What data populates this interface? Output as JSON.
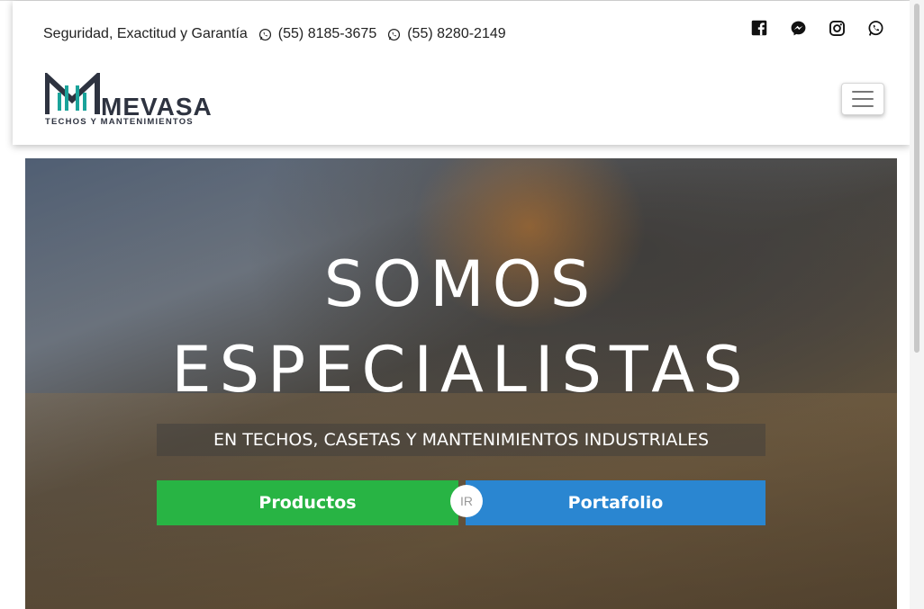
{
  "topbar": {
    "tagline": "Seguridad, Exactitud y Garantía",
    "phones": [
      "(55) 8185-3675",
      "(55) 8280-2149"
    ]
  },
  "socials": [
    "facebook-icon",
    "messenger-icon",
    "instagram-icon",
    "whatsapp-icon"
  ],
  "logo": {
    "brand": "MEVASA",
    "tagline": "TECHOS Y MANTENIMIENTOS"
  },
  "hero": {
    "title_line1": "SOMOS",
    "title_line2": "ESPECIALISTAS",
    "subtitle": "EN TECHOS, CASETAS Y MANTENIMIENTOS INDUSTRIALES",
    "products_label": "Productos",
    "portfolio_label": "Portafolio",
    "divider_label": "IR"
  },
  "colors": {
    "products_button": "#28b444",
    "portfolio_button": "#2a86d1",
    "logo_dark": "#2e3340",
    "logo_accent": "#1aa39a"
  }
}
